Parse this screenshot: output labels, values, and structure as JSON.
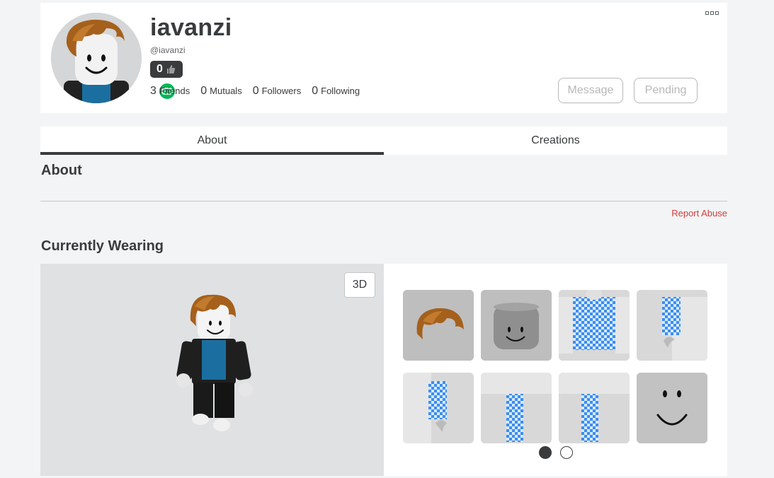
{
  "profile": {
    "display_name": "iavanzi",
    "username": "@iavanzi",
    "badge_count": "0",
    "presence": "in-game"
  },
  "stats": [
    {
      "count": "3",
      "label": "Friends"
    },
    {
      "count": "0",
      "label": "Mutuals"
    },
    {
      "count": "0",
      "label": "Followers"
    },
    {
      "count": "0",
      "label": "Following"
    }
  ],
  "actions": {
    "message_label": "Message",
    "pending_label": "Pending"
  },
  "tabs": [
    {
      "label": "About",
      "active": true
    },
    {
      "label": "Creations",
      "active": false
    }
  ],
  "about": {
    "title": "About",
    "report_label": "Report Abuse"
  },
  "wearing": {
    "title": "Currently Wearing",
    "viewer_toggle_label": "3D",
    "items": [
      {
        "icon": "hair-icon"
      },
      {
        "icon": "head-icon"
      },
      {
        "icon": "shirt-icon"
      },
      {
        "icon": "right-arm-icon"
      },
      {
        "icon": "left-arm-icon"
      },
      {
        "icon": "left-leg-icon"
      },
      {
        "icon": "right-leg-icon"
      },
      {
        "icon": "face-icon"
      }
    ],
    "page_indicator": {
      "pages": 2,
      "current": 1
    }
  },
  "colors": {
    "text": "#393b3d",
    "online": "#02b757",
    "report": "#d63c3c",
    "background": "#f2f4f5"
  }
}
